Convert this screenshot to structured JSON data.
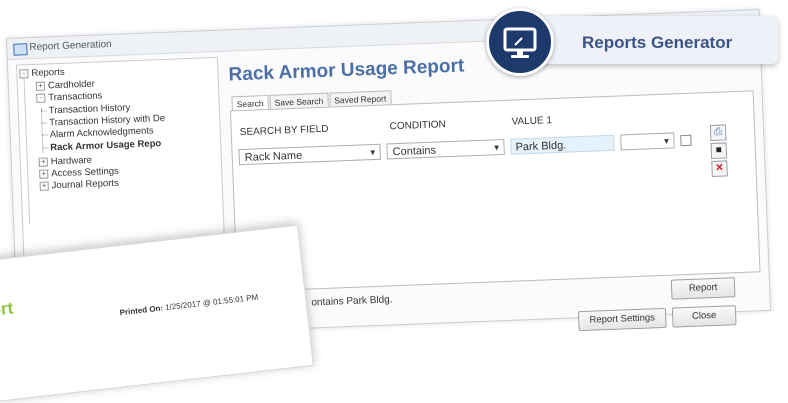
{
  "window": {
    "title": "Report Generation"
  },
  "tree": {
    "root": "Reports",
    "items": [
      {
        "label": "Cardholder",
        "expander": "+"
      },
      {
        "label": "Transactions",
        "expander": "-"
      },
      {
        "label": "Transaction History"
      },
      {
        "label": "Transaction History with De"
      },
      {
        "label": "Alarm Acknowledgments"
      },
      {
        "label": "Rack Armor Usage Repo"
      },
      {
        "label": "Hardware",
        "expander": "+"
      },
      {
        "label": "Access Settings",
        "expander": "+"
      },
      {
        "label": "Journal Reports",
        "expander": "+"
      }
    ]
  },
  "report": {
    "title": "Rack Armor Usage Report"
  },
  "tabs": [
    "Search",
    "Save Search",
    "Saved Report"
  ],
  "search": {
    "headers": [
      "SEARCH BY FIELD",
      "CONDITION",
      "VALUE 1"
    ],
    "field": "Rack Name",
    "condition": "Contains",
    "value": "Park Bldg.",
    "value2": ""
  },
  "status_text": "ontains Park Bldg.",
  "buttons": {
    "report": "Report",
    "report_settings": "Report Settings",
    "close": "Close"
  },
  "paper": {
    "title": "ort",
    "printed_label": "Printed On:",
    "printed_value": "1/25/2017 @ 01:55:01 PM"
  },
  "badge": {
    "label": "Reports Generator"
  },
  "colors": {
    "title_blue": "#4c6fa8",
    "badge_navy": "#1e3a6d",
    "paper_green": "#8dc63f"
  }
}
